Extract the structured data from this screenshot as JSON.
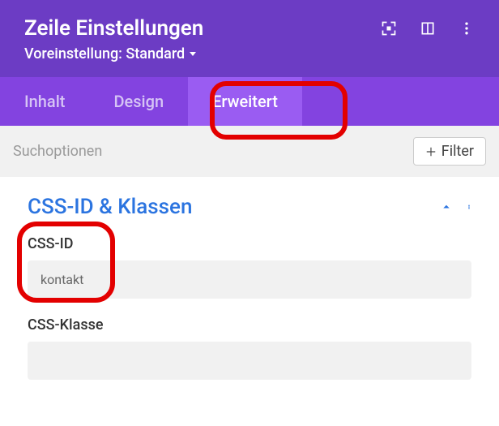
{
  "header": {
    "title": "Zeile Einstellungen",
    "preset_label": "Voreinstellung: Standard"
  },
  "tabs": {
    "items": [
      {
        "label": "Inhalt",
        "active": false
      },
      {
        "label": "Design",
        "active": false
      },
      {
        "label": "Erweitert",
        "active": true
      }
    ]
  },
  "search": {
    "placeholder": "Suchoptionen",
    "filter_label": "Filter"
  },
  "section": {
    "title": "CSS-ID & Klassen"
  },
  "fields": {
    "css_id": {
      "label": "CSS-ID",
      "value": "kontakt"
    },
    "css_class": {
      "label": "CSS-Klasse",
      "value": ""
    }
  },
  "colors": {
    "header_bg": "#6c3cc4",
    "tabs_bg": "#8343e0",
    "tab_active_bg": "#9a5cf2",
    "link": "#2b74e0",
    "annotation": "#e30000"
  }
}
